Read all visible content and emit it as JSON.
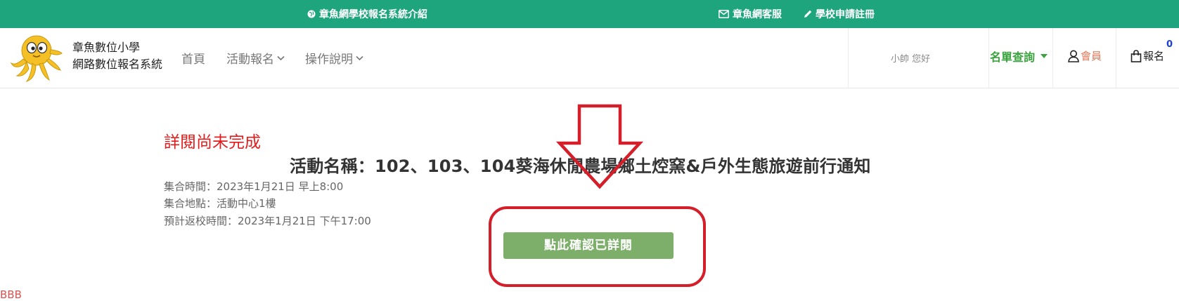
{
  "topbar": {
    "intro_link": "章魚網學校報名系統介紹",
    "service_link": "章魚網客服",
    "register_link": "學校申請註冊"
  },
  "navbar": {
    "brand_line1": "章魚數位小學",
    "brand_line2": "網路數位報名系統",
    "menu": {
      "home": "首頁",
      "activity": "活動報名",
      "manual": "操作說明"
    },
    "greeting": "小帥 您好",
    "list_query": "名單查詢",
    "member": "會員",
    "signup": "報名",
    "cart_count": "0"
  },
  "main": {
    "status": "詳閱尚未完成",
    "event_title": "活動名稱：102、103、104葵海休閒農場鄉土焢窯&戶外生態旅遊前行通知",
    "gather_time": "集合時間：2023年1月21日 早上8:00",
    "gather_place": "集合地點：活動中心1樓",
    "return_time": "預計返校時間：2023年1月21日 下午17:00",
    "confirm_button": "點此確認已詳閱",
    "bottom_fragment": "BBB"
  },
  "colors": {
    "topbar_bg": "#1fa57d",
    "confirm_bg": "#7daf6b",
    "alert_red": "#e21d1d",
    "annotation_red": "#d41f2a",
    "list_query_green": "#3aa33d",
    "member_orange": "#e0795a",
    "cart_badge_blue": "#1a3fd1"
  },
  "icons": {
    "intro": "globe-icon",
    "service": "envelope-icon",
    "register": "pencil-icon",
    "member": "user-icon",
    "signup": "shopping-bag-icon",
    "dropdown": "chevron-down-icon",
    "list_query_dropdown": "caret-down-icon",
    "logo": "octopus-logo"
  }
}
